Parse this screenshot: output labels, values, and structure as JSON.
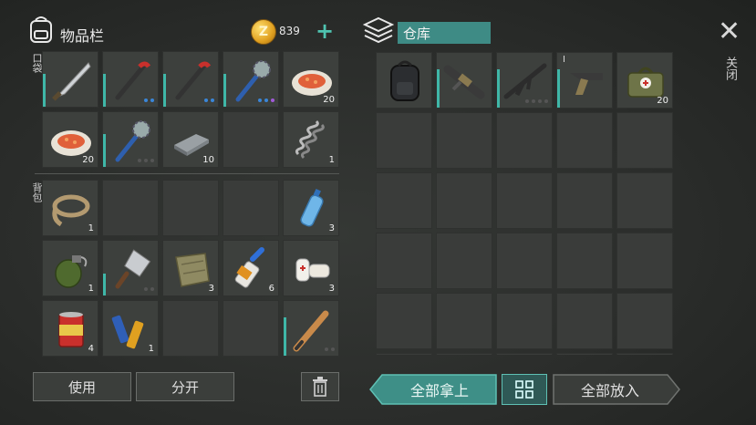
{
  "inventory": {
    "title": "物品栏",
    "coins": "839",
    "coin_symbol": "Z",
    "pocket_label": "口袋",
    "backpack_label": "背包",
    "pocket_slots": [
      {
        "icon": "machete-icon",
        "qty": "",
        "bar": 60,
        "dots": []
      },
      {
        "icon": "crowbar-icon",
        "qty": "",
        "bar": 60,
        "dots": [
          "b",
          "b"
        ]
      },
      {
        "icon": "crowbar-icon",
        "qty": "",
        "bar": 60,
        "dots": [
          "b",
          "b"
        ]
      },
      {
        "icon": "spiked-club-icon",
        "qty": "",
        "bar": 60,
        "dots": [
          "b",
          "b",
          "p"
        ]
      },
      {
        "icon": "food-plate-icon",
        "qty": "20",
        "bar": 0,
        "dots": []
      },
      {
        "icon": "food-plate-icon",
        "qty": "20",
        "bar": 0,
        "dots": []
      },
      {
        "icon": "spiked-club-icon",
        "qty": "",
        "bar": 60,
        "dots": [
          "g",
          "g",
          "g"
        ]
      },
      {
        "icon": "metal-ingot-icon",
        "qty": "10",
        "bar": 0,
        "dots": []
      },
      {
        "icon": "empty",
        "qty": "",
        "bar": 0,
        "dots": []
      },
      {
        "icon": "spring-icon",
        "qty": "1",
        "bar": 0,
        "dots": []
      }
    ],
    "backpack_slots": [
      {
        "icon": "rope-icon",
        "qty": "1",
        "bar": 0,
        "dots": []
      },
      {
        "icon": "empty",
        "qty": "",
        "bar": 0,
        "dots": []
      },
      {
        "icon": "empty",
        "qty": "",
        "bar": 0,
        "dots": []
      },
      {
        "icon": "empty",
        "qty": "",
        "bar": 0,
        "dots": []
      },
      {
        "icon": "water-bottle-icon",
        "qty": "3",
        "bar": 0,
        "dots": []
      },
      {
        "icon": "grenade-icon",
        "qty": "1",
        "bar": 0,
        "dots": []
      },
      {
        "icon": "cleaver-icon",
        "qty": "",
        "bar": 40,
        "dots": [
          "g",
          "g"
        ]
      },
      {
        "icon": "cloth-icon",
        "qty": "3",
        "bar": 0,
        "dots": []
      },
      {
        "icon": "glue-icon",
        "qty": "6",
        "bar": 0,
        "dots": []
      },
      {
        "icon": "bandage-icon",
        "qty": "3",
        "bar": 0,
        "dots": []
      },
      {
        "icon": "canned-food-icon",
        "qty": "4",
        "bar": 0,
        "dots": []
      },
      {
        "icon": "batteries-icon",
        "qty": "1",
        "bar": 0,
        "dots": []
      },
      {
        "icon": "empty",
        "qty": "",
        "bar": 0,
        "dots": []
      },
      {
        "icon": "empty",
        "qty": "",
        "bar": 0,
        "dots": []
      },
      {
        "icon": "baseball-bat-icon",
        "qty": "",
        "bar": 70,
        "dots": [
          "g",
          "g"
        ]
      }
    ],
    "buttons": {
      "use": "使用",
      "split": "分开"
    }
  },
  "warehouse": {
    "title": "仓库",
    "slots": [
      {
        "icon": "backpack-icon",
        "qty": "",
        "bar": 0,
        "dots": [],
        "mark": ""
      },
      {
        "icon": "grenade-launcher-icon",
        "qty": "",
        "bar": 70,
        "dots": [],
        "mark": ""
      },
      {
        "icon": "assault-rifle-icon",
        "qty": "",
        "bar": 70,
        "dots": [
          "g",
          "g",
          "g",
          "g"
        ],
        "mark": ""
      },
      {
        "icon": "pistol-icon",
        "qty": "",
        "bar": 70,
        "dots": [],
        "mark": "I"
      },
      {
        "icon": "medkit-bag-icon",
        "qty": "20",
        "bar": 0,
        "dots": [],
        "mark": ""
      }
    ],
    "buttons": {
      "take_all": "全部拿上",
      "put_all": "全部放入"
    }
  },
  "close": {
    "label": "关闭"
  },
  "colors": {
    "accent": "#3fb7a8",
    "warehouse_title": "#3e8b85",
    "slot": "#3a3c3a"
  }
}
